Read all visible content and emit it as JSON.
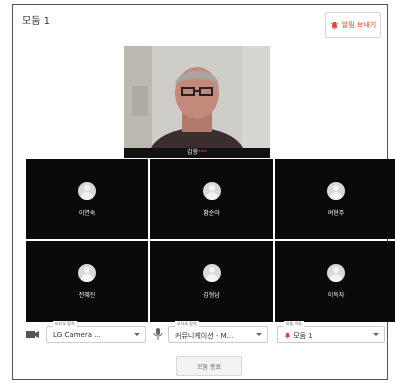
{
  "header": {
    "title": "모둠 1",
    "alert_button": "알림 보내기"
  },
  "main_video": {
    "name": "김향",
    "suffix": "***"
  },
  "participants": [
    {
      "name": "이연숙"
    },
    {
      "name": "황순아"
    },
    {
      "name": "여현주"
    },
    {
      "name": "전혜진"
    },
    {
      "name": "김형남"
    },
    {
      "name": "이득자"
    }
  ],
  "controls": {
    "video": {
      "caption": "비디오 장치",
      "value": "LG Camera ..."
    },
    "audio": {
      "caption": "오디오 장치",
      "value": "커뮤니케이션 - M..."
    },
    "group": {
      "caption": "모둠 이동",
      "value": "모둠 1"
    },
    "end_button": "모둠 종료"
  },
  "colors": {
    "accent": "#e2422b",
    "tile": "#0a0a0a"
  }
}
